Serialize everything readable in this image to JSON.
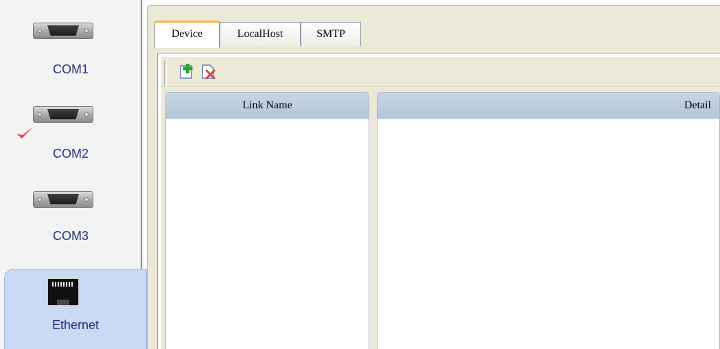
{
  "sidebar": {
    "ports": [
      {
        "label": "COM1",
        "selected": false
      },
      {
        "label": "COM2",
        "selected": true
      },
      {
        "label": "COM3",
        "selected": false
      },
      {
        "label": "Ethernet",
        "selected": false,
        "active": true
      }
    ],
    "check_icon": "checkmark-icon",
    "active_color": "#c9daf5",
    "check_color": "#e0455a"
  },
  "tabs": [
    {
      "label": "Device",
      "active": true
    },
    {
      "label": "LocalHost",
      "active": false
    },
    {
      "label": "SMTP",
      "active": false
    }
  ],
  "toolbar": {
    "buttons": [
      {
        "icon": "add-link-icon"
      },
      {
        "icon": "delete-link-icon"
      }
    ]
  },
  "table": {
    "columns": [
      "Link Name",
      "Detail"
    ],
    "rows": []
  },
  "colors": {
    "panel_bg": "#ece9d8",
    "header_bg": "#b4c6da",
    "tab_accent": "#f7b33b",
    "label_text": "#1f2f7a"
  }
}
